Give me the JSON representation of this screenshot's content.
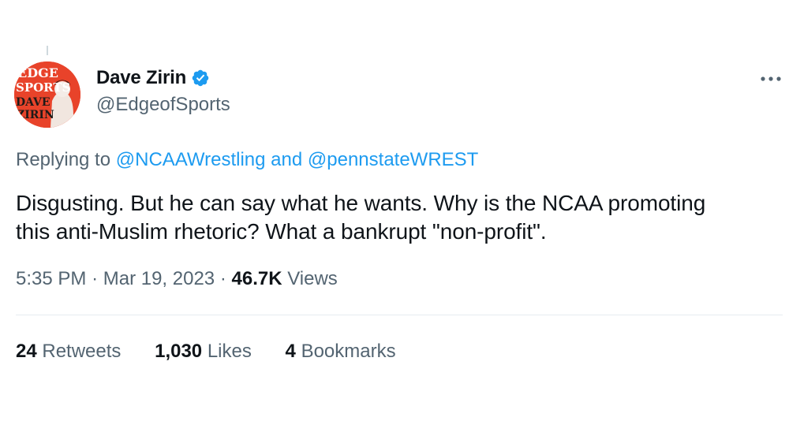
{
  "tweet": {
    "author": {
      "display_name": "Dave Zirin",
      "handle": "@EdgeofSports",
      "verified": true,
      "avatar_text": [
        "EDGE",
        "SPORTS",
        "DAVE",
        "ZIRIN"
      ]
    },
    "reply": {
      "prefix": "Replying to",
      "mention_1": "@NCAAWrestling",
      "joiner": "and",
      "mention_2": "@pennstateWREST"
    },
    "text_line1": "Disgusting. But he can say what he wants. Why is the NCAA promoting",
    "text_line2": "this anti-Muslim rhetoric? What a bankrupt \"non-profit\".",
    "time": "5:35 PM",
    "separator": "·",
    "date": "Mar 19, 2023",
    "views_count": "46.7K",
    "views_label": "Views",
    "stats": {
      "retweets_count": "24",
      "retweets_label": "Retweets",
      "likes_count": "1,030",
      "likes_label": "Likes",
      "bookmarks_count": "4",
      "bookmarks_label": "Bookmarks"
    }
  },
  "colors": {
    "link": "#1d9bf0",
    "secondary_text": "#536471",
    "primary_text": "#0f1419",
    "avatar_bg": "#e8432a"
  }
}
